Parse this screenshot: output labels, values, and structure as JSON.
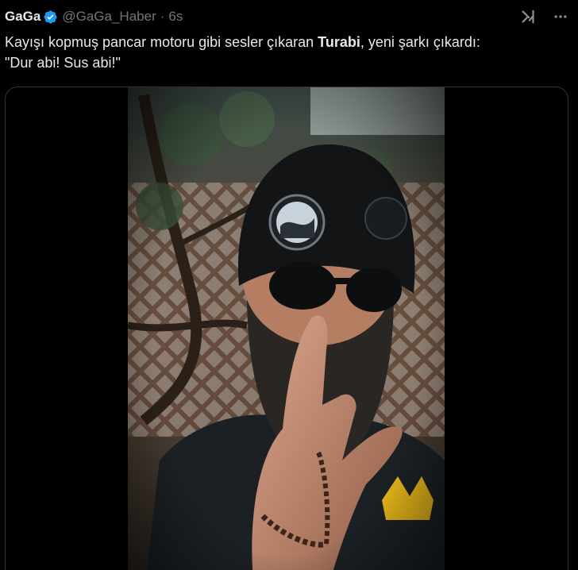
{
  "tweet": {
    "author_name": "GaGa",
    "author_handle": "@GaGa_Haber",
    "separator": "·",
    "timestamp": "6s",
    "text_before": "Kayışı kopmuş pancar motoru gibi sesler çıkaran ",
    "mention": "Turabi",
    "text_after": ", yeni şarkı çıkardı:",
    "text_line2": "\"Dur abi! Sus abi!\""
  },
  "icons": {
    "verified": "verified-badge-icon",
    "grok": "grok-icon",
    "more": "more-options-icon"
  },
  "colors": {
    "background": "#000000",
    "text": "#e7e9ea",
    "secondary": "#71767b",
    "verified": "#1d9bf0",
    "border": "#2f3336"
  }
}
